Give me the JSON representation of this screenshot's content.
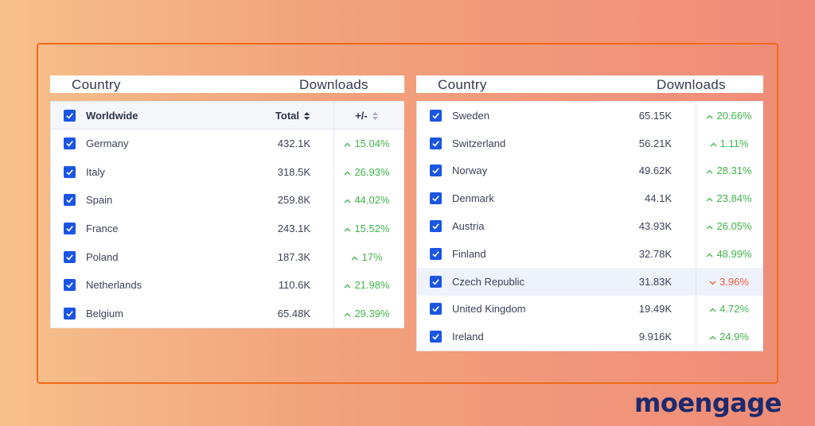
{
  "left_panel": {
    "header_country": "Country",
    "header_downloads": "Downloads",
    "table_head": {
      "name": "Worldwide",
      "total": "Total",
      "change": "+/-"
    },
    "rows": [
      {
        "name": "Germany",
        "total": "432.1K",
        "change": "15.04%",
        "trend": "up"
      },
      {
        "name": "Italy",
        "total": "318.5K",
        "change": "26.93%",
        "trend": "up"
      },
      {
        "name": "Spain",
        "total": "259.8K",
        "change": "44.02%",
        "trend": "up"
      },
      {
        "name": "France",
        "total": "243.1K",
        "change": "15.52%",
        "trend": "up"
      },
      {
        "name": "Poland",
        "total": "187.3K",
        "change": "17%",
        "trend": "up"
      },
      {
        "name": "Netherlands",
        "total": "110.6K",
        "change": "21.98%",
        "trend": "up"
      },
      {
        "name": "Belgium",
        "total": "65.48K",
        "change": "29.39%",
        "trend": "up"
      }
    ]
  },
  "right_panel": {
    "header_country": "Country",
    "header_downloads": "Downloads",
    "rows": [
      {
        "name": "Sweden",
        "total": "65.15K",
        "change": "20.66%",
        "trend": "up"
      },
      {
        "name": "Switzerland",
        "total": "56.21K",
        "change": "1.11%",
        "trend": "up"
      },
      {
        "name": "Norway",
        "total": "49.62K",
        "change": "28.31%",
        "trend": "up"
      },
      {
        "name": "Denmark",
        "total": "44.1K",
        "change": "23.84%",
        "trend": "up"
      },
      {
        "name": "Austria",
        "total": "43.93K",
        "change": "26.05%",
        "trend": "up"
      },
      {
        "name": "Finland",
        "total": "32.78K",
        "change": "48.99%",
        "trend": "up"
      },
      {
        "name": "Czech Republic",
        "total": "31.83K",
        "change": "3.96%",
        "trend": "down"
      },
      {
        "name": "United Kingdom",
        "total": "19.49K",
        "change": "4.72%",
        "trend": "up"
      },
      {
        "name": "Ireland",
        "total": "9.916K",
        "change": "24.9%",
        "trend": "up"
      }
    ]
  },
  "brand": {
    "logo_text": "moengage"
  },
  "colors": {
    "checkbox": "#1a55e3",
    "up": "#3fb44a",
    "down": "#ef5a3a",
    "frame": "#f26a1b",
    "brand": "#1d2a6b"
  },
  "icons": {
    "checkbox": "checkmark-icon",
    "up": "chevron-up-icon",
    "down": "chevron-down-icon",
    "sort": "sort-icon"
  }
}
